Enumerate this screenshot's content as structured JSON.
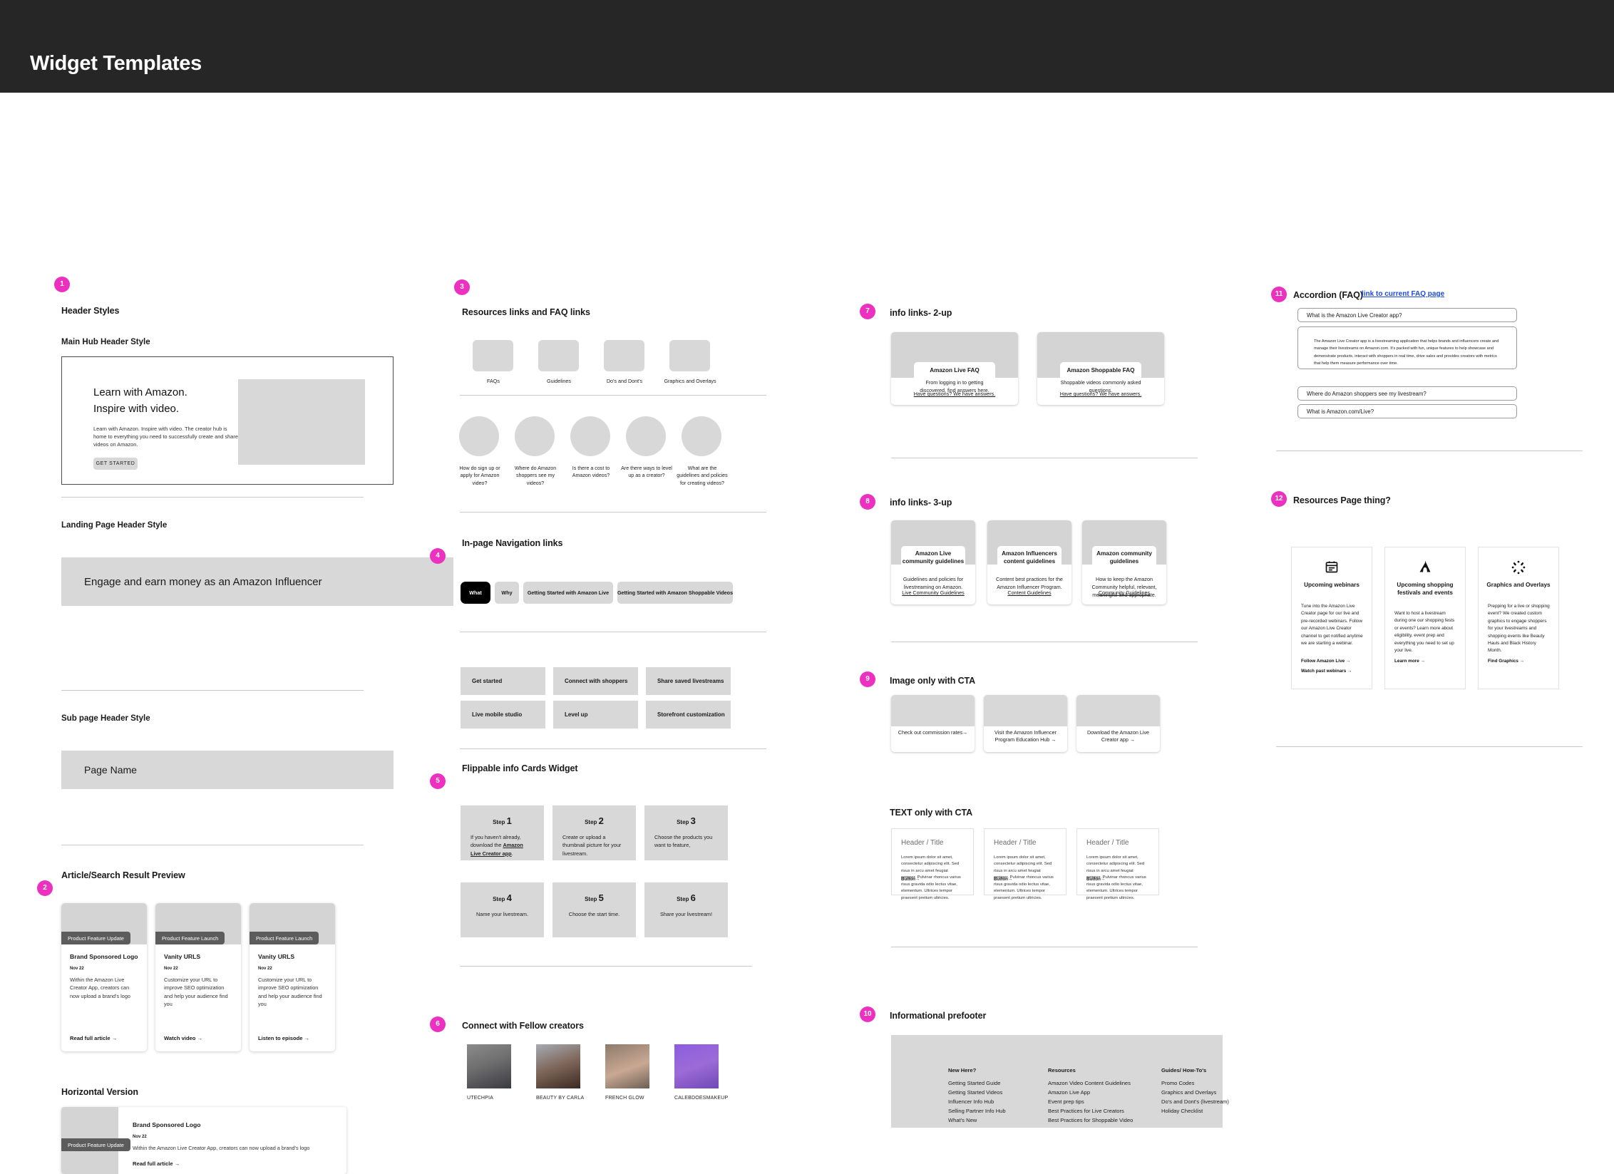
{
  "app": {
    "title": "Widget Templates"
  },
  "sections": {
    "s1": {
      "badge": "1",
      "title": "Header Styles",
      "main_hub_label": "Main Hub Header Style",
      "hub": {
        "headline_line1": "Learn with Amazon.",
        "headline_line2": "Inspire with video.",
        "paragraph": "Learn with Amazon. Inspire with video. The creator hub is home to everything you need to successfully create and share videos on Amazon.",
        "button": "GET STARTED"
      },
      "landing_label": "Landing Page Header Style",
      "landing_headline": "Engage and earn money as an Amazon Influencer",
      "subpage_label": "Sub page Header Style",
      "subpage_headline": "Page Name"
    },
    "s2": {
      "badge": "2",
      "title": "Article/Search Result Preview",
      "cards": [
        {
          "tag": "Product Feature Update",
          "title": "Brand Sponsored Logo",
          "date": "Nov 22",
          "desc": "Within the Amazon Live Creator App, creators can now upload a brand's logo",
          "cta": "Read full article →"
        },
        {
          "tag": "Product Feature Launch",
          "title": "Vanity URLS",
          "date": "Nov 22",
          "desc": "Customize your URL to improve SEO optimization and help your audience find you",
          "cta": "Watch video →"
        },
        {
          "tag": "Product Feature Launch",
          "title": "Vanity URLS",
          "date": "Nov 22",
          "desc": "Customize your URL to improve SEO optimization and help your audience find you",
          "cta": "Listen to episode →"
        }
      ],
      "horizontal_label": "Horizontal Version",
      "horizontal": {
        "tag": "Product Feature Update",
        "title": "Brand Sponsored Logo",
        "date": "Nov 22",
        "desc": "Within the Amazon Live Creator App, creators can now upload a brand's logo",
        "cta": "Read full article →"
      }
    },
    "s3": {
      "badge": "3",
      "title": "Resources links and FAQ links",
      "tiles": [
        "FAQs",
        "Guidelines",
        "Do's and Dont's",
        "Graphics and Overlays"
      ],
      "circles": [
        "How do sign up or apply for Amazon video?",
        "Where do Amazon shoppers see my videos?",
        "Is there a cost to Amazon videos?",
        "Are there ways to level up as a creator?",
        "What are the guidelines and policies for creating videos?"
      ]
    },
    "s4": {
      "badge": "4",
      "title": "In-page Navigation links",
      "pills": [
        "What",
        "Why",
        "Getting  Started with Amazon Live",
        "Getting  Started with Amazon Shoppable Videos"
      ],
      "boxes": [
        "Get started",
        "Connect with shoppers",
        "Share saved livestreams",
        "Live mobile studio",
        "Level up",
        "Storefront customization"
      ]
    },
    "s5": {
      "badge": "5",
      "title": "Flippable info Cards Widget",
      "steps": [
        {
          "label": "Step",
          "num": "1",
          "text_before": "If you haven't already, download the ",
          "link": "Amazon Live Creator app",
          "text_after": ".",
          "centered": false
        },
        {
          "label": "Step",
          "num": "2",
          "text": "Create or upload a thumbnail picture for your livestream.",
          "centered": false
        },
        {
          "label": "Step",
          "num": "3",
          "text": "Choose the products you want to feature,",
          "centered": false
        },
        {
          "label": "Step",
          "num": "4",
          "text": "Name your livestream.",
          "centered": true
        },
        {
          "label": "Step",
          "num": "5",
          "text": "Choose the start time.",
          "centered": true
        },
        {
          "label": "Step",
          "num": "6",
          "text": "Share your livestream!",
          "centered": true
        }
      ]
    },
    "s6": {
      "badge": "6",
      "title": "Connect with Fellow creators",
      "creators": [
        {
          "name": "UTECHPIA",
          "c1": "#6f6f6f",
          "c2": "#3a3a42"
        },
        {
          "name": "BEAUTY BY CARLA",
          "c1": "#9aa0a8",
          "c2": "#4b3a33"
        },
        {
          "name": "FRENCH GLOW",
          "c1": "#6d5f54",
          "c2": "#cfae9a"
        },
        {
          "name": "CALEBDOESMAKEUP",
          "c1": "#7b4fd1",
          "c2": "#a06bd8"
        }
      ]
    },
    "s7": {
      "badge": "7",
      "title": "info links- 2-up",
      "cards": [
        {
          "title": "Amazon Live FAQ",
          "desc": "From logging in to getting discovered, find answers here.",
          "link": "Have questions? We have answers."
        },
        {
          "title": "Amazon Shoppable FAQ",
          "desc": "Shoppable videos commonly asked questions.",
          "link": "Have questions? We have answers."
        }
      ]
    },
    "s8": {
      "badge": "8",
      "title": "info links- 3-up",
      "cards": [
        {
          "title": "Amazon Live community guidelines",
          "desc": "Guidelines and policies for livestreaming on Amazon.",
          "link": "Live Community Guidelines"
        },
        {
          "title": "Amazon Influencers content guidelines",
          "desc": "Content best practices for the Amazon Influencer Program.",
          "link": "Content Guidelines"
        },
        {
          "title": "Amazon community guidelines",
          "desc": "How to keep the Amazon Community helpful, relevant, meaningful and appropriate.",
          "link": "Community Guidelines"
        }
      ]
    },
    "s9": {
      "badge": "9",
      "title": "Image only with CTA",
      "cards": [
        "Check out commission rates→",
        "Visit the Amazon Influencer Program Education Hub →",
        "Download the Amazon Live Creator app →"
      ],
      "text_only_title": "TEXT only with CTA",
      "text_cards": [
        {
          "header": "Header / Title",
          "body": "Lorem ipsum dolor sit amet, consectetur adipiscing elit. Sed risus in arcu amet feugiat semper. Pulvinar rhoncus varius risus gravida odio lectus vitae, elementum. Ultrices tempor praesent pretium ultricies.",
          "button": "Button→"
        },
        {
          "header": "Header / Title",
          "body": "Lorem ipsum dolor sit amet, consectetur adipiscing elit. Sed risus in arcu amet feugiat semper. Pulvinar rhoncus varius risus gravida odio lectus vitae, elementum. Ultrices tempor praesent pretium ultricies.",
          "button": "Button→"
        },
        {
          "header": "Header / Title",
          "body": "Lorem ipsum dolor sit amet, consectetur adipiscing elit. Sed risus in arcu amet feugiat semper. Pulvinar rhoncus varius risus gravida odio lectus vitae, elementum. Ultrices tempor praesent pretium ultricies.",
          "button": "Button→"
        }
      ]
    },
    "s10": {
      "badge": "10",
      "title": "Informational prefooter",
      "columns": [
        {
          "heading": "New Here?",
          "items": [
            "Getting Started Guide",
            "Getting Started Videos",
            "Influencer Info Hub",
            "Selling Partner Info Hub",
            "What's New"
          ]
        },
        {
          "heading": "Resources",
          "items": [
            "Amazon Video Content Guidelines",
            "Amazon Live App",
            "Event prep tips",
            "Best Practices for Live Creators",
            "Best Practices for Shoppable Video"
          ]
        },
        {
          "heading": "Guides/ How-To's",
          "items": [
            "Promo Codes",
            "Graphics and Overlays",
            "Do's and Dont's (livestream)",
            "Holiday Checklist"
          ]
        }
      ]
    },
    "s11": {
      "badge": "11",
      "title": "Accordion (FAQ)",
      "link": "link to current FAQ page",
      "row1": "What is the Amazon Live Creator app?",
      "answer": "The Amazon Live Creator app is a livestreaming application that helps brands and influencers create and manage their livestreams on Amazon.com. It's packed with fun, unique features to help showcase and demonstrate products, interact with shoppers in real time, drive sales and provides creators with metrics that help them measure performance over time.",
      "row2": "Where do Amazon shoppers see my livestream?",
      "row3": "What is Amazon.com/Live?"
    },
    "s12": {
      "badge": "12",
      "title": "Resources Page thing?",
      "cards": [
        {
          "icon": "calendar-icon",
          "title": "Upcoming webinars",
          "body": "Tune into the Amazon Live Creator page for our live and pre-recorded webinars. Follow our Amazon Live Creator channel to get notified anytime we are starting a webinar.",
          "cta1": "Follow Amazon Live →",
          "cta2": "Watch past webinars →"
        },
        {
          "icon": "tent-icon",
          "title": "Upcoming shopping festivals and events",
          "body": "Want to host a livestream during one our shopping fests or events? Learn more about eligibility, event prep and everything you need to set up your live.",
          "cta1": "Learn more →",
          "cta2": ""
        },
        {
          "icon": "sparkle-icon",
          "title": "Graphics and Overlays",
          "body": "Prepping for a live or shopping event? We created custom graphics to engage shoppers for your livestreams and shopping events like Beauty Hauls and Black History Month.",
          "cta1": "Find Graphics →",
          "cta2": ""
        }
      ]
    }
  },
  "colors": {
    "accent": "#ec30c0",
    "topbar": "#262626",
    "placeholder": "#d8d8d8",
    "tag": "#5c5c5c",
    "link": "#1a4ae0"
  }
}
